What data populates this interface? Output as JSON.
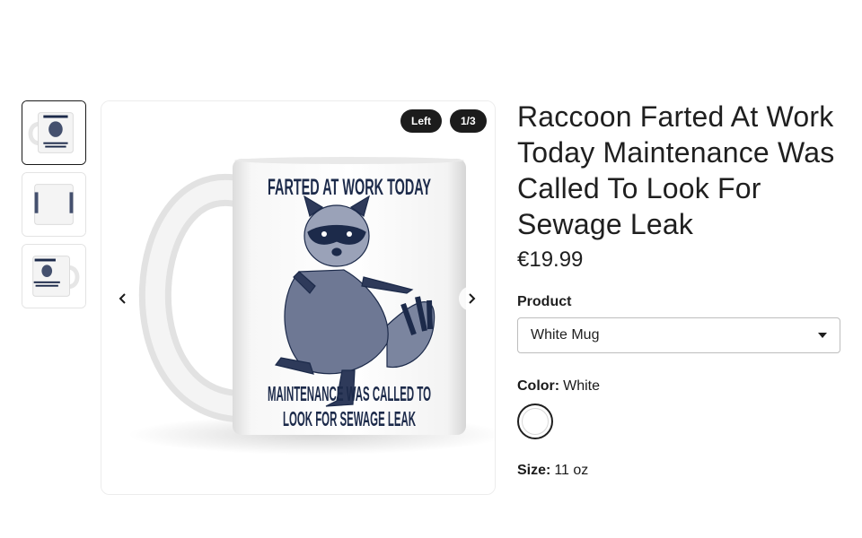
{
  "gallery": {
    "badge_side": "Left",
    "badge_count": "1/3",
    "mug_text_top": "FARTED AT WORK TODAY",
    "mug_text_bottom_1": "MAINTENANCE WAS CALLED TO",
    "mug_text_bottom_2": "LOOK FOR SEWAGE LEAK"
  },
  "product": {
    "title": "Raccoon Farted At Work Today Maintenance Was Called To Look For Sewage Leak",
    "price": "€19.99",
    "product_label": "Product",
    "product_value": "White Mug",
    "color_label": "Color:",
    "color_value": "White",
    "size_label": "Size:",
    "size_value": "11 oz"
  },
  "colors": {
    "ink": "#1c2a4a",
    "badge_bg": "#1c1c1c"
  }
}
